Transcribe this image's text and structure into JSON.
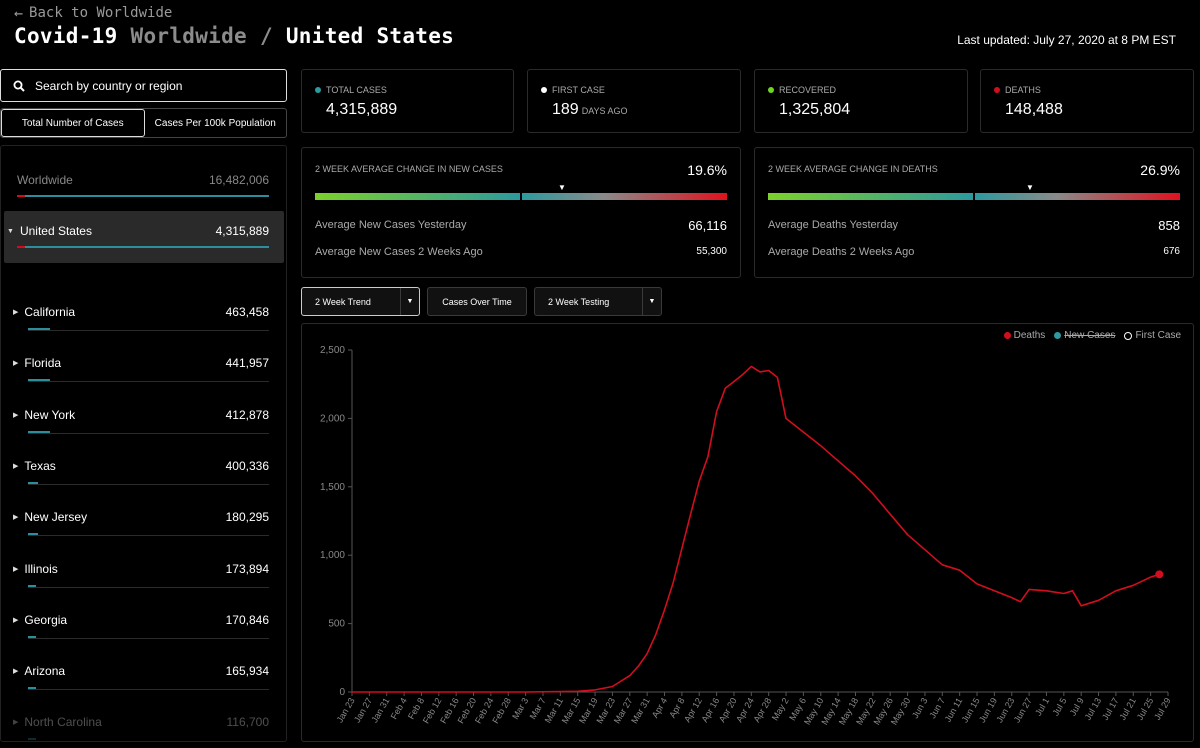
{
  "header": {
    "back_label": "Back to Worldwide",
    "title_main": "Covid-19",
    "title_worldwide": "Worldwide",
    "title_sep": "/",
    "title_country": "United States",
    "last_updated": "Last updated: July 27, 2020 at 8 PM EST"
  },
  "sidebar": {
    "search_placeholder": "Search by country or region",
    "toggle": [
      "Total Number of Cases",
      "Cases Per 100k Population"
    ],
    "worldwide": {
      "label": "Worldwide",
      "value": "16,482,006"
    },
    "selected": {
      "label": "United States",
      "value": "4,315,889"
    },
    "states": [
      {
        "name": "California",
        "value": "463,458"
      },
      {
        "name": "Florida",
        "value": "441,957"
      },
      {
        "name": "New York",
        "value": "412,878"
      },
      {
        "name": "Texas",
        "value": "400,336"
      },
      {
        "name": "New Jersey",
        "value": "180,295"
      },
      {
        "name": "Illinois",
        "value": "173,894"
      },
      {
        "name": "Georgia",
        "value": "170,846"
      },
      {
        "name": "Arizona",
        "value": "165,934"
      },
      {
        "name": "North Carolina",
        "value": "116,700"
      }
    ]
  },
  "stats": {
    "total_cases": {
      "label": "TOTAL CASES",
      "value": "4,315,889",
      "color": "#2c9a9e"
    },
    "first_case": {
      "label": "FIRST CASE",
      "value": "189",
      "unit": "DAYS AGO",
      "color": "#ffffff"
    },
    "recovered": {
      "label": "RECOVERED",
      "value": "1,325,804",
      "color": "#6fd620"
    },
    "deaths": {
      "label": "DEATHS",
      "value": "148,488",
      "color": "#d10e1e"
    }
  },
  "trend_cases": {
    "label": "2 WEEK AVERAGE CHANGE IN NEW CASES",
    "pct": "19.6%",
    "yesterday_label": "Average New Cases Yesterday",
    "yesterday_value": "66,116",
    "two_weeks_label": "Average New Cases 2 Weeks Ago",
    "two_weeks_value": "55,300"
  },
  "trend_deaths": {
    "label": "2 WEEK AVERAGE CHANGE IN DEATHS",
    "pct": "26.9%",
    "yesterday_label": "Average Deaths Yesterday",
    "yesterday_value": "858",
    "two_weeks_label": "Average Deaths 2 Weeks Ago",
    "two_weeks_value": "676"
  },
  "controls": {
    "trend": "2 Week Trend",
    "cases_over_time": "Cases Over Time",
    "testing": "2 Week Testing"
  },
  "legend": {
    "deaths": "Deaths",
    "new_cases": "New Cases",
    "first_case": "First Case"
  },
  "chart_data": {
    "type": "line",
    "title": "",
    "xlabel": "",
    "ylabel": "",
    "ylim": [
      0,
      2500
    ],
    "yticks": [
      "0",
      "500",
      "1,000",
      "1,500",
      "2,000",
      "2,500"
    ],
    "grid": false,
    "legend_position": "top-right",
    "x_tick_labels": [
      "Jan 23",
      "Jan 27",
      "Jan 31",
      "Feb 4",
      "Feb 8",
      "Feb 12",
      "Feb 16",
      "Feb 20",
      "Feb 24",
      "Feb 28",
      "Mar 3",
      "Mar 7",
      "Mar 11",
      "Mar 15",
      "Mar 19",
      "Mar 23",
      "Mar 27",
      "Mar 31",
      "Apr 4",
      "Apr 8",
      "Apr 12",
      "Apr 16",
      "Apr 20",
      "Apr 24",
      "Apr 28",
      "May 2",
      "May 6",
      "May 10",
      "May 14",
      "May 18",
      "May 22",
      "May 26",
      "May 30",
      "Jun 3",
      "Jun 7",
      "Jun 11",
      "Jun 15",
      "Jun 19",
      "Jun 23",
      "Jun 27",
      "Jul 1",
      "Jul 5",
      "Jul 9",
      "Jul 13",
      "Jul 17",
      "Jul 21",
      "Jul 25",
      "Jul 29"
    ],
    "series": [
      {
        "name": "Deaths",
        "color": "#d10e1e",
        "x": [
          "Jan 23",
          "Mar 3",
          "Mar 15",
          "Mar 19",
          "Mar 23",
          "Mar 27",
          "Mar 29",
          "Mar 31",
          "Apr 2",
          "Apr 4",
          "Apr 6",
          "Apr 8",
          "Apr 10",
          "Apr 12",
          "Apr 14",
          "Apr 16",
          "Apr 18",
          "Apr 20",
          "Apr 22",
          "Apr 24",
          "Apr 26",
          "Apr 28",
          "Apr 30",
          "May 2",
          "May 6",
          "May 10",
          "May 14",
          "May 18",
          "May 22",
          "May 26",
          "May 30",
          "Jun 3",
          "Jun 7",
          "Jun 11",
          "Jun 15",
          "Jun 19",
          "Jun 23",
          "Jun 25",
          "Jun 27",
          "Jul 1",
          "Jul 5",
          "Jul 7",
          "Jul 9",
          "Jul 13",
          "Jul 17",
          "Jul 21",
          "Jul 25",
          "Jul 27"
        ],
        "y": [
          0,
          0,
          5,
          15,
          40,
          120,
          190,
          280,
          420,
          600,
          800,
          1050,
          1300,
          1540,
          1720,
          2050,
          2220,
          2270,
          2320,
          2380,
          2340,
          2350,
          2300,
          2000,
          1900,
          1800,
          1690,
          1580,
          1450,
          1300,
          1150,
          1040,
          930,
          890,
          790,
          740,
          690,
          660,
          750,
          740,
          720,
          740,
          630,
          670,
          740,
          780,
          840,
          860
        ]
      }
    ]
  }
}
